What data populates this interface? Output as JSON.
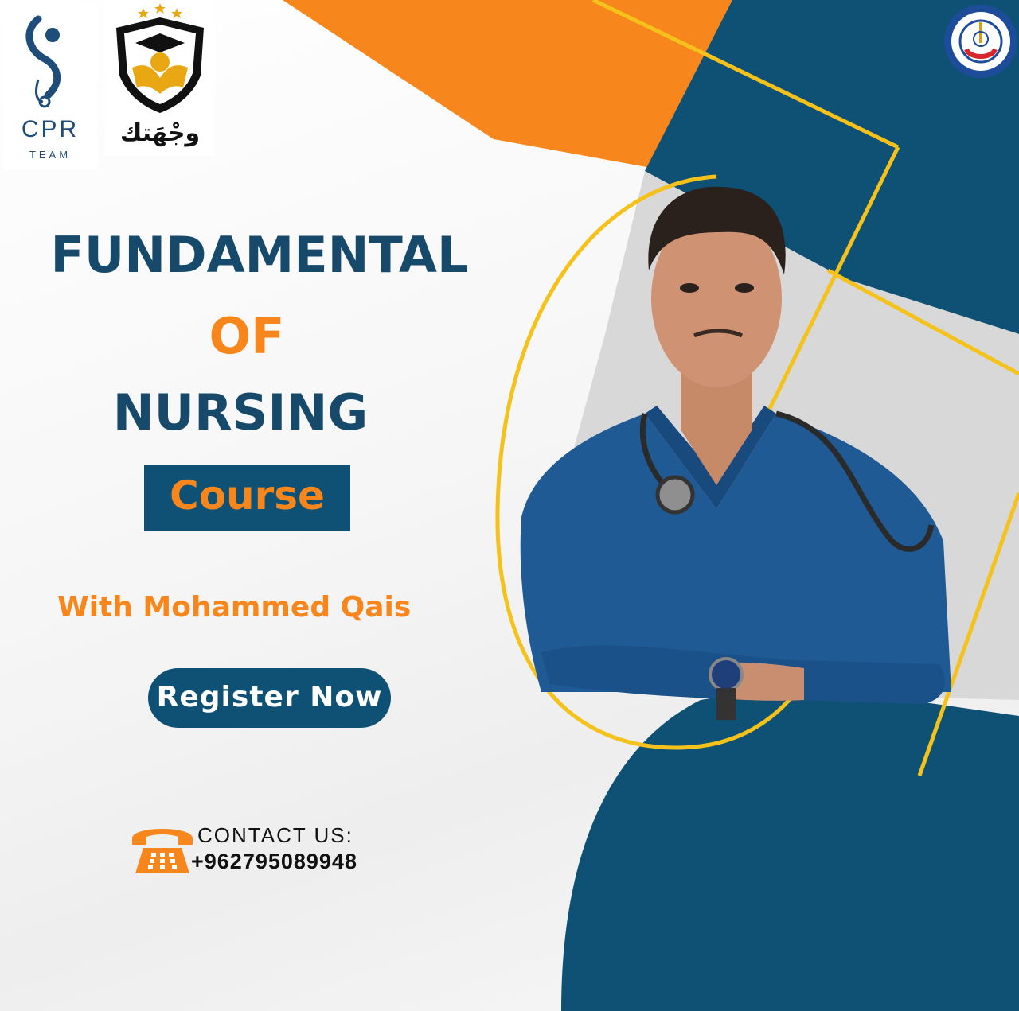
{
  "logos": {
    "cpr": {
      "name": "CPR",
      "sub": "TEAM"
    },
    "wajhatak": {
      "name": "وجْهَتك"
    },
    "university": {
      "icon": "university-seal-icon"
    }
  },
  "title": {
    "line1": "FUNDAMENTAL",
    "line2": "OF",
    "line3": "NURSING",
    "course": "Course"
  },
  "instructor": "With Mohammed Qais",
  "register": "Register Now",
  "contact": {
    "label": "CONTACT US:",
    "phone": "+962795089948",
    "icon": "telephone-icon"
  },
  "colors": {
    "navy": "#0f5175",
    "orange": "#f7861c",
    "yellow": "#f4c21a",
    "grey": "#d6d6d6"
  }
}
